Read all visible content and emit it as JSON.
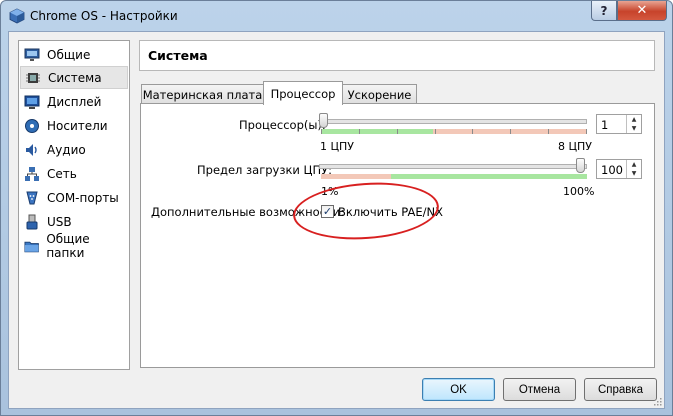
{
  "window": {
    "title": "Chrome OS  - Настройки",
    "help_label": "?",
    "close_label": "✕"
  },
  "sidebar": {
    "items": [
      {
        "label": "Общие",
        "icon": "monitor-icon",
        "selected": false
      },
      {
        "label": "Система",
        "icon": "chip-icon",
        "selected": true
      },
      {
        "label": "Дисплей",
        "icon": "display-icon",
        "selected": false
      },
      {
        "label": "Носители",
        "icon": "disk-icon",
        "selected": false
      },
      {
        "label": "Аудио",
        "icon": "speaker-icon",
        "selected": false
      },
      {
        "label": "Сеть",
        "icon": "network-icon",
        "selected": false
      },
      {
        "label": "COM-порты",
        "icon": "serial-port-icon",
        "selected": false
      },
      {
        "label": "USB",
        "icon": "usb-icon",
        "selected": false
      },
      {
        "label": "Общие папки",
        "icon": "folder-icon",
        "selected": false
      }
    ]
  },
  "header": {
    "title": "Система"
  },
  "tabs": [
    {
      "label": "Материнская плата",
      "active": false
    },
    {
      "label": "Процессор",
      "active": true
    },
    {
      "label": "Ускорение",
      "active": false
    }
  ],
  "processor": {
    "cpu_label": "Процессор(ы):",
    "cpu_value": "1",
    "cpu_min_label": "1 ЦПУ",
    "cpu_max_label": "8 ЦПУ",
    "cpu_level_fraction": 0,
    "cap_label": "Предел загрузки ЦПУ:",
    "cap_value": "100",
    "cap_min_label": "1%",
    "cap_max_label": "100%",
    "cap_level_fraction": 1,
    "extended_label": "Дополнительные возможности:",
    "pae_label": "Включить PAE/NX",
    "pae_checked": true
  },
  "buttons": {
    "ok": "OK",
    "cancel": "Отмена",
    "help": "Справка"
  },
  "colors": {
    "accent": "#3c7fb1",
    "highlight_circle": "#d82020",
    "zone_green": "#a8e6a0",
    "zone_red": "#f3c8b8"
  }
}
